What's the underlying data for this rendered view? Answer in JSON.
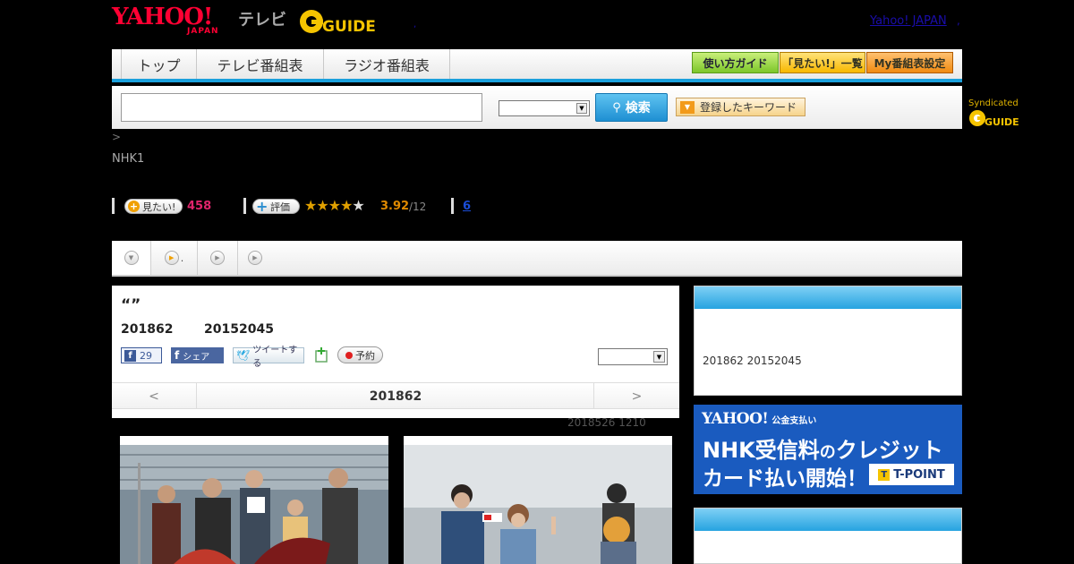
{
  "header": {
    "logo_yahoo": "YAHOO!",
    "logo_japan": "JAPAN",
    "logo_tv": "テレビ",
    "logo_gguide": "GUIDE",
    "yahoo_japan_link": "Yahoo! JAPAN",
    "link_sep": ","
  },
  "nav": {
    "tabs": [
      "トップ",
      "テレビ番組表",
      "ラジオ番組表"
    ],
    "guide_buttons": [
      "使い方ガイド",
      "「見たい!」一覧",
      "My番組表設定"
    ]
  },
  "search": {
    "button_label": "検索",
    "keyword_button": "登録したキーワード",
    "syndicated": "Syndicated",
    "input_value": "",
    "select_value": ""
  },
  "breadcrumb": ">",
  "channel": "NHK1",
  "stats": {
    "want_label": "見たい!",
    "want_count": "458",
    "rate_label": "評価",
    "rating": 3.92,
    "rating_text": "3.92",
    "rating_count": "/12",
    "review_link": "6"
  },
  "program_tabs": [
    "",
    ".",
    "",
    ""
  ],
  "program": {
    "title": "“”",
    "date": "201862",
    "date_range": "20152045",
    "fb_count": "29",
    "share_label": "シェア",
    "tweet_label": "ツイートする",
    "reserve_label": "予約",
    "select_value": ""
  },
  "pager": {
    "prev": "<",
    "current": "201862",
    "next": ">"
  },
  "updated": "2018526  1210",
  "sidebar": {
    "date_line": "201862  20152045",
    "banner": {
      "brand": "YAHOO!",
      "brand_sub": "公金支払い",
      "line1_a": "NHK受信料",
      "line1_b": "の",
      "line1_c": "クレジット",
      "line2": "カード払い開始！",
      "tpoint": "T-POINT"
    }
  },
  "colors": {
    "accent_blue": "#1aa0dc",
    "want_pink": "#e0246b",
    "rating_orange": "#e08a00",
    "yahoo_red": "#ff0033",
    "banner_blue": "#1a5bbf"
  }
}
